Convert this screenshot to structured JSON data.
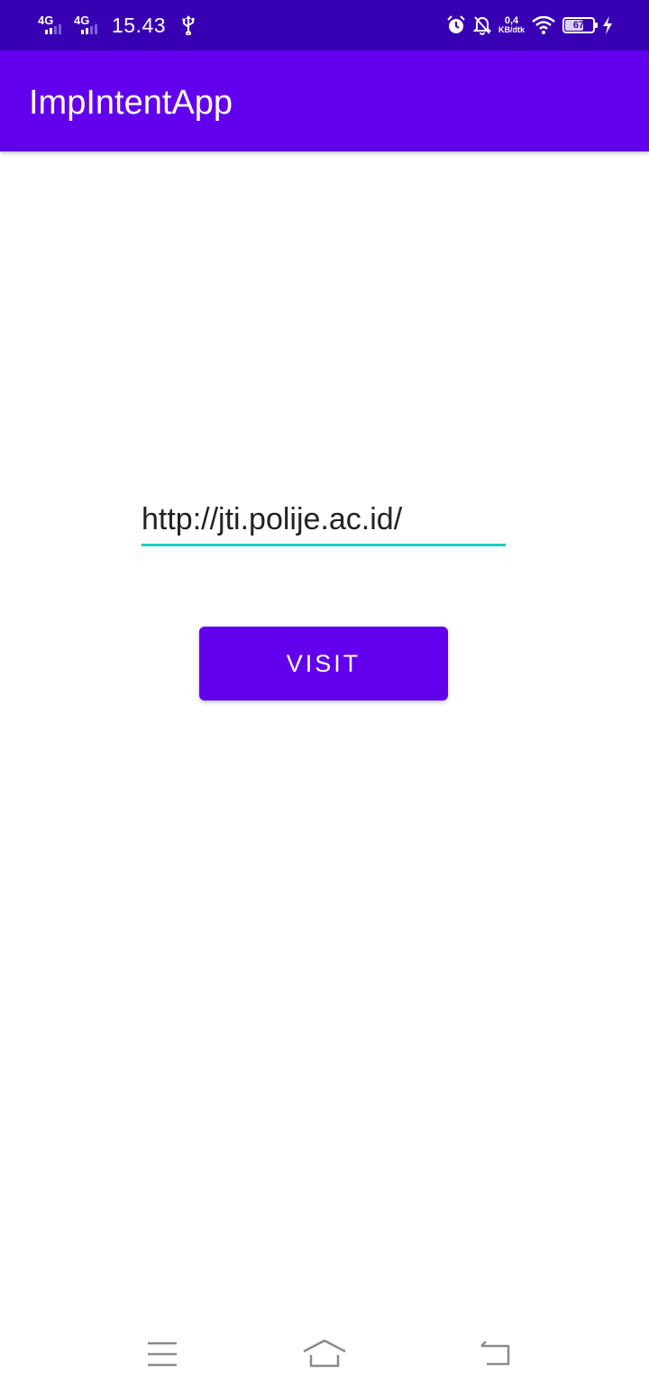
{
  "status_bar": {
    "signal1_label": "4G",
    "signal2_label": "4G",
    "time": "15.43",
    "net_speed_value": "0,4",
    "net_speed_unit": "KB/dtk",
    "battery_level": "67"
  },
  "app_bar": {
    "title": "ImpIntentApp"
  },
  "main": {
    "url_input_value": "http://jti.polije.ac.id/",
    "visit_label": "VISIT"
  },
  "colors": {
    "status_bar": "#3700b3",
    "primary": "#6200ee",
    "input_underline": "#1fcfc4",
    "nav_icon": "#8a8a8a"
  },
  "icons": {
    "usb": "usb-icon",
    "alarm": "alarm-icon",
    "notifications_off": "notifications-off-icon",
    "wifi": "wifi-icon",
    "charging": "charging-bolt-icon",
    "nav_menu": "menu-icon",
    "nav_home": "home-icon",
    "nav_back": "back-icon"
  }
}
